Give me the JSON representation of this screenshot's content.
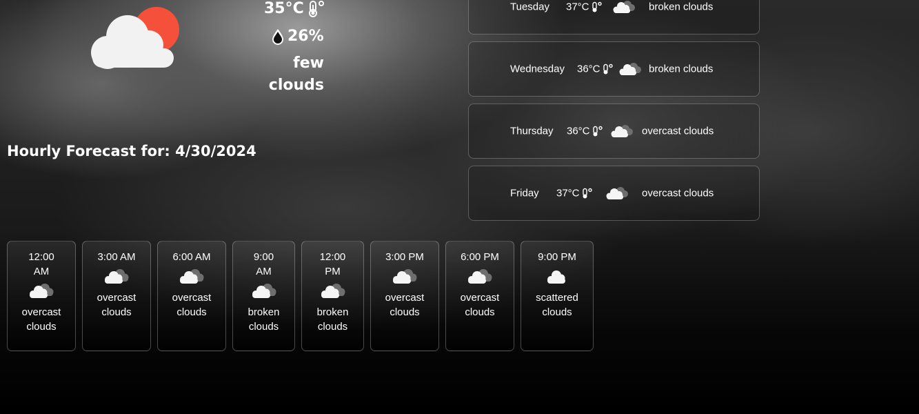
{
  "current": {
    "temperature": "35°C",
    "humidity": "26%",
    "description_line1": "few",
    "description_line2": "clouds",
    "icon": "few-clouds-sun-icon",
    "sun_color": "#f4503a"
  },
  "hourly": {
    "title": "Hourly Forecast for: 4/30/2024",
    "items": [
      {
        "time_line1": "12:00",
        "time_line2": "AM",
        "desc_line1": "overcast",
        "desc_line2": "clouds",
        "icon": "overcast-clouds-icon"
      },
      {
        "time_line1": "3:00 AM",
        "time_line2": "",
        "desc_line1": "overcast",
        "desc_line2": "clouds",
        "icon": "overcast-clouds-icon"
      },
      {
        "time_line1": "6:00 AM",
        "time_line2": "",
        "desc_line1": "overcast",
        "desc_line2": "clouds",
        "icon": "overcast-clouds-icon"
      },
      {
        "time_line1": "9:00",
        "time_line2": "AM",
        "desc_line1": "broken",
        "desc_line2": "clouds",
        "icon": "broken-clouds-icon"
      },
      {
        "time_line1": "12:00",
        "time_line2": "PM",
        "desc_line1": "broken",
        "desc_line2": "clouds",
        "icon": "broken-clouds-icon"
      },
      {
        "time_line1": "3:00 PM",
        "time_line2": "",
        "desc_line1": "overcast",
        "desc_line2": "clouds",
        "icon": "overcast-clouds-icon"
      },
      {
        "time_line1": "6:00 PM",
        "time_line2": "",
        "desc_line1": "overcast",
        "desc_line2": "clouds",
        "icon": "overcast-clouds-icon"
      },
      {
        "time_line1": "9:00 PM",
        "time_line2": "",
        "desc_line1": "scattered",
        "desc_line2": "clouds",
        "icon": "scattered-clouds-icon"
      }
    ]
  },
  "daily": {
    "items": [
      {
        "day": "Tuesday",
        "temp": "37°C",
        "desc": "broken clouds",
        "icon": "broken-clouds-icon"
      },
      {
        "day": "Wednesday",
        "temp": "36°C",
        "desc": "broken clouds",
        "icon": "broken-clouds-icon"
      },
      {
        "day": "Thursday",
        "temp": "36°C",
        "desc": "overcast clouds",
        "icon": "overcast-clouds-icon"
      },
      {
        "day": "Friday",
        "temp": "37°C",
        "desc": "overcast clouds",
        "icon": "overcast-clouds-icon"
      }
    ]
  }
}
